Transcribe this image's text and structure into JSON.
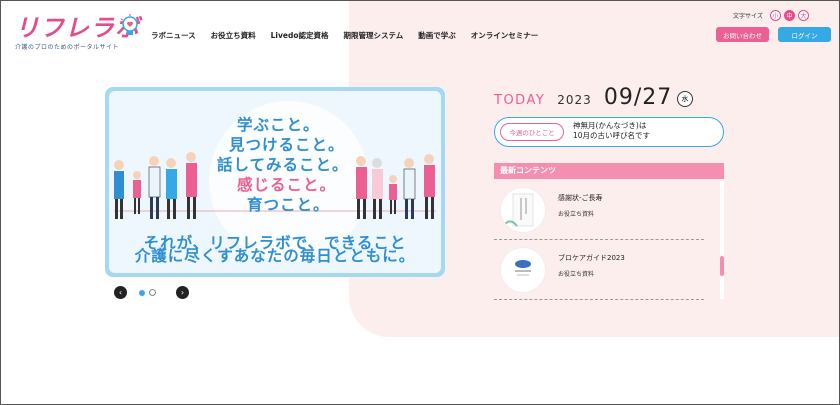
{
  "header": {
    "logo_text": "リフレラボ",
    "logo_sub": "介護のプロのためのポータルサイト",
    "nav": [
      "ラボニュース",
      "お役立ち資料",
      "Livedo認定資格",
      "期限管理システム",
      "動画で学ぶ",
      "オンラインセミナー"
    ],
    "font_size_label": "文字サイズ",
    "font_sizes": [
      "小",
      "中",
      "大"
    ],
    "contact_label": "お問い合わせ",
    "login_label": "ログイン"
  },
  "hero": {
    "lines": [
      "学ぶこと。",
      "見つけること。",
      "話してみること。",
      "感じること。",
      "育つこと。"
    ],
    "sub1": "それが、リフレラボで、できること",
    "sub2": "介護に尽くすあなたの毎日とともに。",
    "slide_count": 2,
    "active_slide": 1
  },
  "today": {
    "label": "TODAY",
    "year": "2023",
    "date": "09/27",
    "dow": "水"
  },
  "word_of_week": {
    "tag": "今週のひとこと",
    "line1": "神無月(かんなづき)は",
    "line2": "10月の古い呼び名です"
  },
  "latest": {
    "heading": "最新コンテンツ",
    "items": [
      {
        "title": "感謝状-ご長寿",
        "category": "お役立ち資料"
      },
      {
        "title": "ブロケアガイド2023",
        "category": "お役立ち資料"
      }
    ]
  },
  "colors": {
    "pink": "#ec5f92",
    "blue": "#35a9e6",
    "pink_bg": "#fdeeee"
  }
}
